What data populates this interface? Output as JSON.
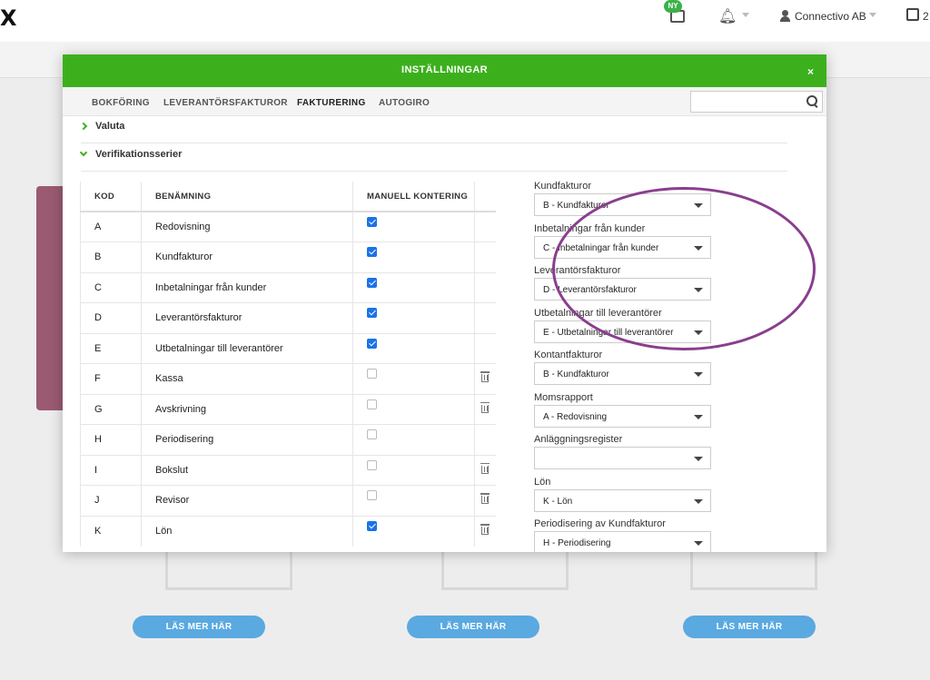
{
  "topbar": {
    "logo": "X",
    "ny_badge": "NY",
    "user_name": "Connectivo AB",
    "calendar_num": "2"
  },
  "background": {
    "read_more_buttons": [
      "LÄS MER HÄR",
      "LÄS MER HÄR",
      "LÄS MER HÄR"
    ]
  },
  "modal": {
    "title": "INSTÄLLNINGAR",
    "close": "×",
    "tabs": [
      "BOKFÖRING",
      "LEVERANTÖRSFAKTUROR",
      "FAKTURERING",
      "AUTOGIRO"
    ],
    "active_tab": "FAKTURERING",
    "search_placeholder": "",
    "sections": {
      "valuta": "Valuta",
      "verifikationsserier": "Verifikationsserier"
    },
    "table": {
      "headers": [
        "KOD",
        "BENÄMNING",
        "MANUELL KONTERING"
      ],
      "rows": [
        {
          "kod": "A",
          "name": "Redovisning",
          "manual": true,
          "deletable": false
        },
        {
          "kod": "B",
          "name": "Kundfakturor",
          "manual": true,
          "deletable": false
        },
        {
          "kod": "C",
          "name": "Inbetalningar från kunder",
          "manual": true,
          "deletable": false
        },
        {
          "kod": "D",
          "name": "Leverantörsfakturor",
          "manual": true,
          "deletable": false
        },
        {
          "kod": "E",
          "name": "Utbetalningar till leverantörer",
          "manual": true,
          "deletable": false
        },
        {
          "kod": "F",
          "name": "Kassa",
          "manual": false,
          "deletable": true
        },
        {
          "kod": "G",
          "name": "Avskrivning",
          "manual": false,
          "deletable": true
        },
        {
          "kod": "H",
          "name": "Periodisering",
          "manual": false,
          "deletable": false
        },
        {
          "kod": "I",
          "name": "Bokslut",
          "manual": false,
          "deletable": true
        },
        {
          "kod": "J",
          "name": "Revisor",
          "manual": false,
          "deletable": true
        },
        {
          "kod": "K",
          "name": "Lön",
          "manual": true,
          "deletable": true
        }
      ]
    },
    "fields": [
      {
        "label": "Kundfakturor",
        "value": "B - Kundfakturor"
      },
      {
        "label": "Inbetalningar från kunder",
        "value": "C - Inbetalningar från kunder"
      },
      {
        "label": "Leverantörsfakturor",
        "value": "D - Leverantörsfakturor"
      },
      {
        "label": "Utbetalningar till leverantörer",
        "value": "E - Utbetalningar till leverantörer"
      },
      {
        "label": "Kontantfakturor",
        "value": "B - Kundfakturor"
      },
      {
        "label": "Momsrapport",
        "value": "A - Redovisning"
      },
      {
        "label": "Anläggningsregister",
        "value": ""
      },
      {
        "label": "Lön",
        "value": "K - Lön"
      },
      {
        "label": "Periodisering av Kundfakturor",
        "value": "H - Periodisering"
      }
    ]
  },
  "colors": {
    "header_green": "#3cb01c",
    "checkbox_blue": "#1a73e8",
    "annotation_purple": "#8a3e8e",
    "read_more_blue": "#5aa9e0"
  }
}
